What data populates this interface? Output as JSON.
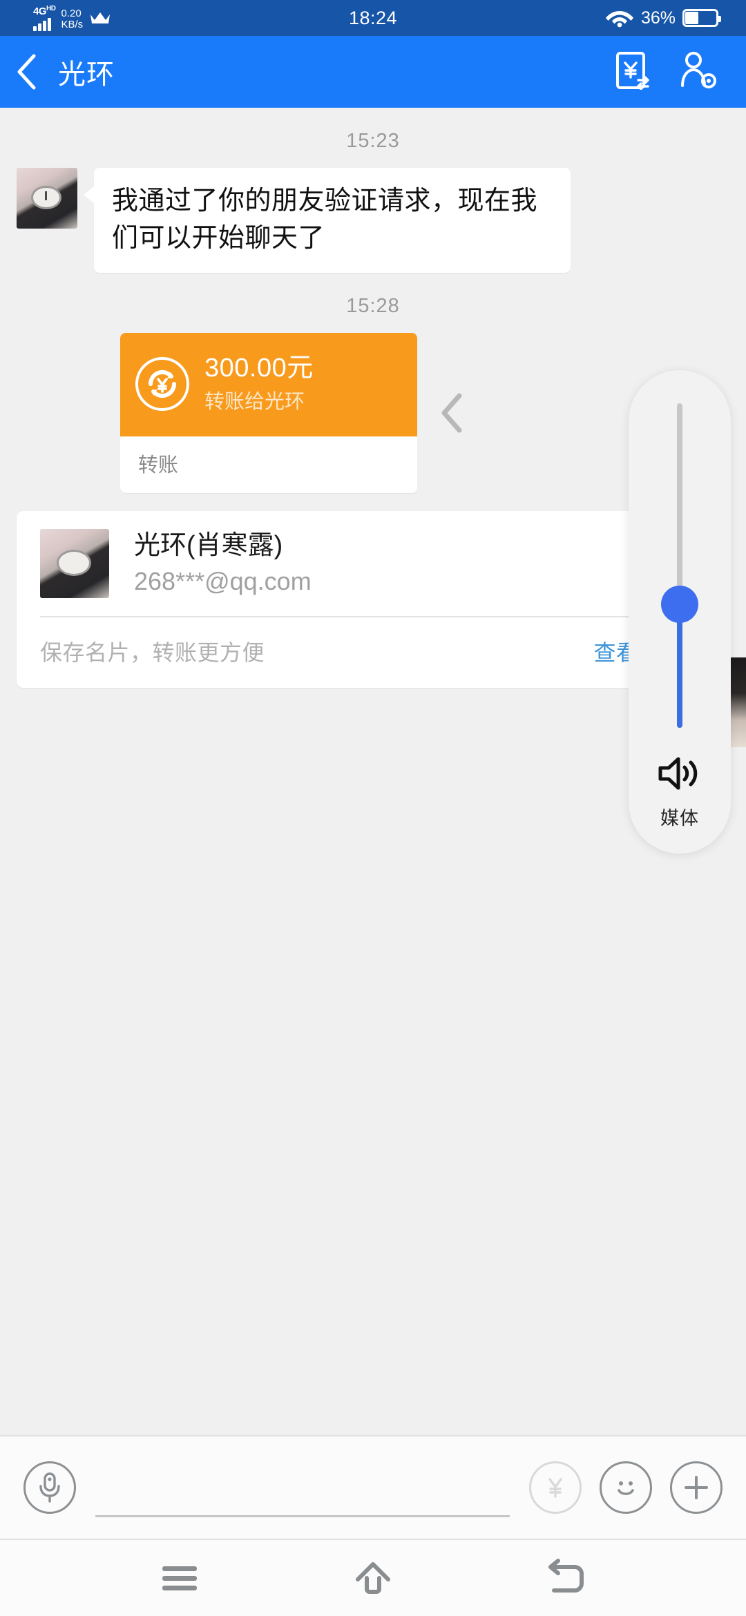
{
  "status_bar": {
    "network_type": "4G",
    "network_sup": "HD",
    "speed_value": "0.20",
    "speed_unit": "KB/s",
    "crown_icon": "crown-icon",
    "time": "18:24",
    "wifi_icon": "wifi-icon",
    "battery_percent": "36%",
    "battery_icon": "battery-icon",
    "bg_color": "#1655a8"
  },
  "app_bar": {
    "back_icon": "back-chevron-icon",
    "title": "光环",
    "transfer_icon": "transfer-money-icon",
    "profile_settings_icon": "person-settings-icon",
    "bg_color": "#1a7bfa"
  },
  "chat": {
    "timestamp_1": "15:23",
    "incoming_message": "我通过了你的朋友验证请求，现在我们可以开始聊天了",
    "avatar_icon": "contact-avatar",
    "timestamp_2": "15:28",
    "transfer": {
      "money_icon": "money-transfer-circle-icon",
      "amount": "300.00元",
      "subtitle": "转账给光环",
      "footer_label": "转账",
      "card_color": "#f89a1c",
      "chevron_icon": "chevron-left-icon"
    },
    "namecard": {
      "avatar_icon": "namecard-avatar",
      "name": "光环(肖寒露)",
      "email": "268***@qq.com",
      "hint": "保存名片，转账更方便",
      "link": "查看名片夹",
      "link_color": "#3d94d9"
    }
  },
  "volume_overlay": {
    "speaker_icon": "speaker-volume-icon",
    "label": "媒体",
    "level_percent": 38,
    "accent_color": "#3d6ef0",
    "track_color": "#c7c7c7"
  },
  "input_bar": {
    "voice_icon": "microphone-icon",
    "input_value": "",
    "input_placeholder": "",
    "money_icon": "yuan-circle-icon",
    "emoji_icon": "smiley-face-icon",
    "plus_icon": "plus-circle-icon"
  },
  "nav_bar": {
    "menu_icon": "menu-recents-icon",
    "home_icon": "home-icon",
    "back_icon": "back-arrow-icon"
  }
}
